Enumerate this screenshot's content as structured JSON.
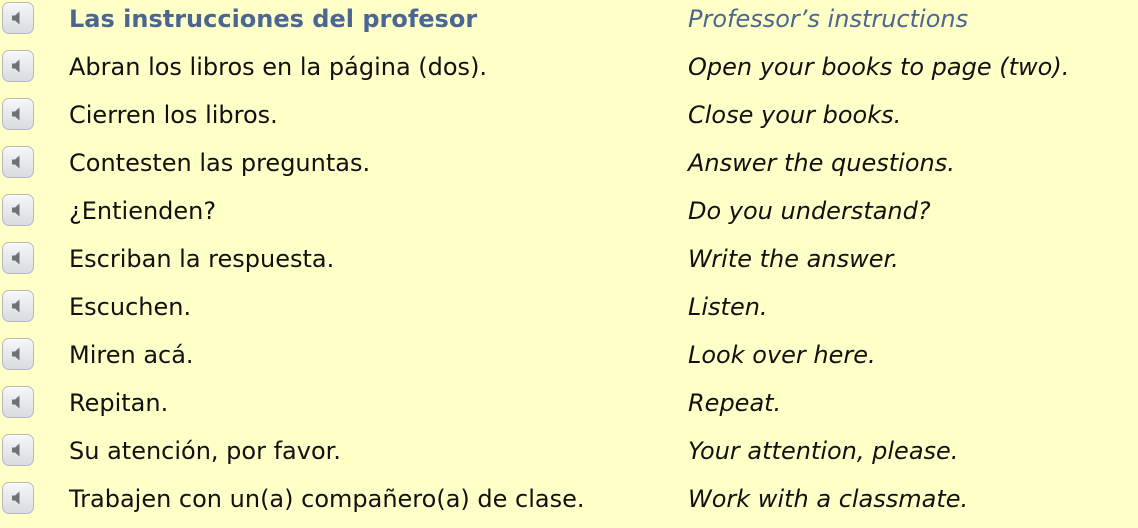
{
  "header": {
    "spanish": "Las instrucciones del profesor",
    "english": "Professor’s instructions"
  },
  "rows": [
    {
      "spanish": "Abran los libros en la página (dos).",
      "english": "Open your books to page (two)."
    },
    {
      "spanish": "Cierren los libros.",
      "english": "Close your books."
    },
    {
      "spanish": "Contesten las preguntas.",
      "english": "Answer the questions."
    },
    {
      "spanish": "¿Entienden?",
      "english": "Do you understand?"
    },
    {
      "spanish": "Escriban la respuesta.",
      "english": "Write the answer."
    },
    {
      "spanish": "Escuchen.",
      "english": "Listen."
    },
    {
      "spanish": "Miren acá.",
      "english": "Look over here."
    },
    {
      "spanish": "Repitan.",
      "english": "Repeat."
    },
    {
      "spanish": "Su atención, por favor.",
      "english": "Your attention, please."
    },
    {
      "spanish": "Trabajen con un(a) compañero(a) de clase.",
      "english": "Work with a classmate."
    }
  ],
  "icons": {
    "audio": "speaker-icon"
  },
  "colors": {
    "background": "#ffffc8",
    "header_text": "#4a6691",
    "body_text": "#111111"
  }
}
